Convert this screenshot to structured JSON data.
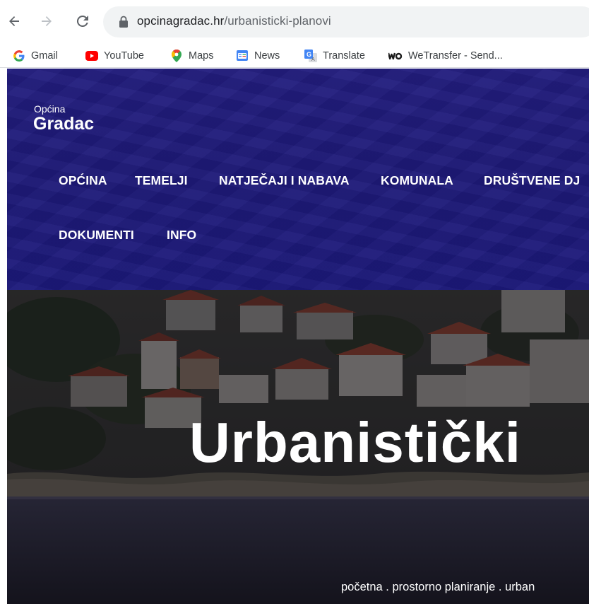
{
  "browser": {
    "url_domain": "opcinagradac.hr",
    "url_path": "/urbanisticki-planovi",
    "bookmarks": [
      {
        "label": "Gmail",
        "icon": "google-icon"
      },
      {
        "label": "YouTube",
        "icon": "youtube-icon"
      },
      {
        "label": "Maps",
        "icon": "maps-icon"
      },
      {
        "label": "News",
        "icon": "news-icon"
      },
      {
        "label": "Translate",
        "icon": "translate-icon"
      },
      {
        "label": "WeTransfer - Send...",
        "icon": "wetransfer-icon"
      }
    ]
  },
  "site": {
    "brand_small": "Općina",
    "brand_big": "Gradac",
    "menu": [
      {
        "label": "OPĆINA"
      },
      {
        "label": "TEMELJI"
      },
      {
        "label": "NATJEČAJI I NABAVA"
      },
      {
        "label": "KOMUNALA"
      },
      {
        "label": "DRUŠTVENE DJ"
      },
      {
        "label": "DOKUMENTI"
      },
      {
        "label": "INFO"
      }
    ],
    "hero_title": "Urbanistički",
    "breadcrumb": "početna . prostorno planiranje . urban"
  },
  "colors": {
    "header_bg": "#1e1a78",
    "hero_dark": "#1c1a25",
    "text_white": "#ffffff"
  }
}
